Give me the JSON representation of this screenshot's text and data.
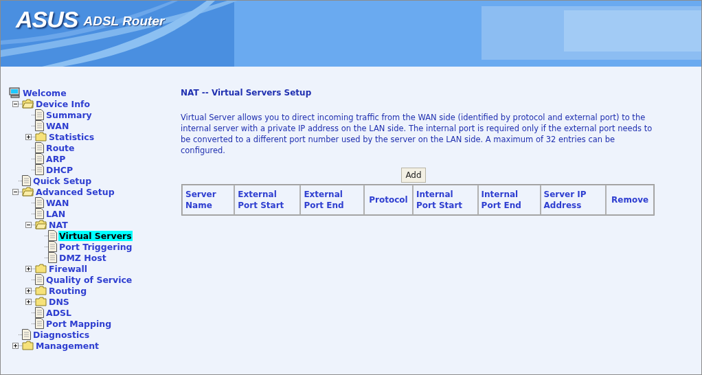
{
  "header": {
    "logo": "ASUS",
    "product": "ADSL Router"
  },
  "tree": [
    {
      "label": "Welcome",
      "kind": "computer",
      "selected": false,
      "children": [
        {
          "label": "Device Info",
          "kind": "folder",
          "expanded": true,
          "selected": false,
          "children": [
            {
              "label": "Summary",
              "kind": "page",
              "selected": false
            },
            {
              "label": "WAN",
              "kind": "page",
              "selected": false
            },
            {
              "label": "Statistics",
              "kind": "folder",
              "expanded": false,
              "selected": false
            },
            {
              "label": "Route",
              "kind": "page",
              "selected": false
            },
            {
              "label": "ARP",
              "kind": "page",
              "selected": false
            },
            {
              "label": "DHCP",
              "kind": "page",
              "selected": false
            }
          ]
        },
        {
          "label": "Quick Setup",
          "kind": "page",
          "selected": false
        },
        {
          "label": "Advanced Setup",
          "kind": "folder",
          "expanded": true,
          "selected": false,
          "children": [
            {
              "label": "WAN",
              "kind": "page",
              "selected": false
            },
            {
              "label": "LAN",
              "kind": "page",
              "selected": false
            },
            {
              "label": "NAT",
              "kind": "folder",
              "expanded": true,
              "selected": false,
              "children": [
                {
                  "label": "Virtual Servers",
                  "kind": "page",
                  "selected": true
                },
                {
                  "label": "Port Triggering",
                  "kind": "page",
                  "selected": false
                },
                {
                  "label": "DMZ Host",
                  "kind": "page",
                  "selected": false
                }
              ]
            },
            {
              "label": "Firewall",
              "kind": "folder",
              "expanded": false,
              "selected": false
            },
            {
              "label": "Quality of Service",
              "kind": "page",
              "selected": false
            },
            {
              "label": "Routing",
              "kind": "folder",
              "expanded": false,
              "selected": false
            },
            {
              "label": "DNS",
              "kind": "folder",
              "expanded": false,
              "selected": false
            },
            {
              "label": "ADSL",
              "kind": "page",
              "selected": false
            },
            {
              "label": "Port Mapping",
              "kind": "page",
              "selected": false
            }
          ]
        },
        {
          "label": "Diagnostics",
          "kind": "page",
          "selected": false
        },
        {
          "label": "Management",
          "kind": "folder",
          "expanded": false,
          "selected": false
        }
      ]
    }
  ],
  "content": {
    "title": "NAT -- Virtual Servers Setup",
    "description": "Virtual Server allows you to direct incoming traffic from the WAN side (identified by protocol and external port) to the internal server with a private IP address on the LAN side. The internal port is required only if the external port needs to be converted to a different port number used by the server on the LAN side. A maximum of 32 entries can be configured.",
    "add_button": "Add",
    "table": {
      "columns": [
        "Server Name",
        "External Port Start",
        "External Port End",
        "Protocol",
        "Internal Port Start",
        "Internal Port End",
        "Server IP Address",
        "Remove"
      ]
    }
  }
}
